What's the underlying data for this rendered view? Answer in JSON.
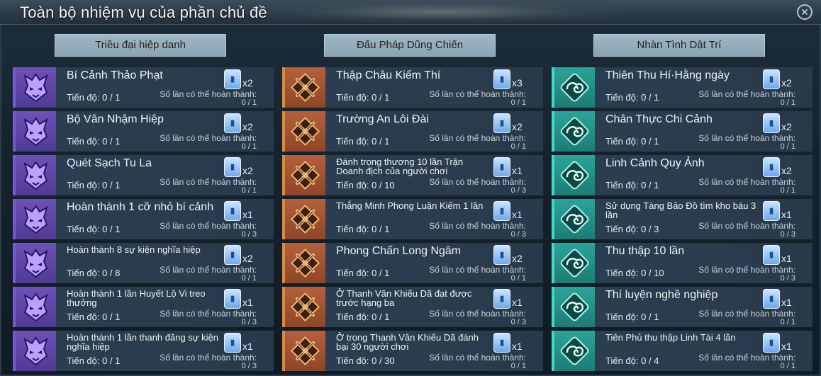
{
  "window": {
    "title": "Toàn bộ nhiệm vụ của phần chủ đề",
    "close_symbol": "✕"
  },
  "columns": [
    {
      "header": "Triều đại hiệp danh",
      "icon": "demon-mask-icon",
      "accent": "#7b56d8",
      "tasks": [
        {
          "name": "Bí Cảnh Thảo Phạt",
          "progress": "Tiến độ: 0 / 1",
          "reward_count": "x2",
          "remain_label": "Số lần có thể hoàn thành:",
          "remain_value": "0 / 1"
        },
        {
          "name": "Bộ Vân Nhậm Hiệp",
          "progress": "Tiến độ: 0 / 1",
          "reward_count": "x2",
          "remain_label": "Số lần có thể hoàn thành:",
          "remain_value": "0 / 1"
        },
        {
          "name": "Quét Sạch Tu La",
          "progress": "Tiến độ: 0 / 1",
          "reward_count": "x2",
          "remain_label": "Số lần có thể hoàn thành:",
          "remain_value": "0 / 1"
        },
        {
          "name": "Hoàn thành 1 cỡ nhỏ bí cảnh",
          "progress": "Tiến độ: 0 / 1",
          "reward_count": "x1",
          "remain_label": "Số lần có thể hoàn thành:",
          "remain_value": "0 / 3"
        },
        {
          "name": "Hoàn thành 8 sự kiện nghĩa hiệp",
          "progress": "Tiến độ: 0 / 8",
          "reward_count": "x2",
          "remain_label": "Số lần có thể hoàn thành:",
          "remain_value": "0 / 1"
        },
        {
          "name": "Hoàn thành 1 lần Huyết Lộ Vi treo thưởng",
          "progress": "Tiến độ: 0 / 1",
          "reward_count": "x1",
          "remain_label": "Số lần có thể hoàn thành:",
          "remain_value": "0 / 3"
        },
        {
          "name": "Hoàn thành 1 lần thanh đăng sự kiện nghĩa hiệp",
          "progress": "Tiến độ: 0 / 1",
          "reward_count": "x1",
          "remain_label": "Số lần có thể hoàn thành:",
          "remain_value": "0 / 3"
        }
      ]
    },
    {
      "header": "Đấu Pháp Dũng Chiến",
      "icon": "crossed-swords-icon",
      "accent": "#d8894e",
      "tasks": [
        {
          "name": "Thập Châu Kiếm Thí",
          "progress": "Tiến độ: 0 / 1",
          "reward_count": "x3",
          "remain_label": "Số lần có thể hoàn thành:",
          "remain_value": "0 / 1"
        },
        {
          "name": "Trường An Lôi Đài",
          "progress": "Tiến độ: 0 / 1",
          "reward_count": "x2",
          "remain_label": "Số lần có thể hoàn thành:",
          "remain_value": "0 / 1"
        },
        {
          "name": "Đánh trọng thương 10 lần Trận Doanh địch của người chơi",
          "progress": "Tiến độ: 0 / 10",
          "reward_count": "x1",
          "remain_label": "Số lần có thể hoàn thành:",
          "remain_value": "0 / 3"
        },
        {
          "name": "Thắng Minh Phong Luận Kiếm 1 lần",
          "progress": "Tiến độ: 0 / 1",
          "reward_count": "x1",
          "remain_label": "Số lần có thể hoàn thành:",
          "remain_value": "0 / 3"
        },
        {
          "name": "Phong Chấn Long Ngâm",
          "progress": "Tiến độ: 0 / 1",
          "reward_count": "x2",
          "remain_label": "Số lần có thể hoàn thành:",
          "remain_value": "0 / 1"
        },
        {
          "name": "Ở Thanh Vân Khiếu Dã đạt được trước hạng ba",
          "progress": "Tiến độ: 0 / 1",
          "reward_count": "x1",
          "remain_label": "Số lần có thể hoàn thành:",
          "remain_value": "0 / 3"
        },
        {
          "name": "Ở trong Thanh Vân Khiếu Dã đánh bại 30 người chơi",
          "progress": "Tiến độ: 0 / 30",
          "reward_count": "x1",
          "remain_label": "Số lần có thể hoàn thành:",
          "remain_value": "0 / 1"
        }
      ]
    },
    {
      "header": "Nhàn Tình Dật Trí",
      "icon": "scroll-cloud-icon",
      "accent": "#45d6c4",
      "tasks": [
        {
          "name": "Thiên Thu Hí·Hằng ngày",
          "progress": "Tiến độ: 0 / 1",
          "reward_count": "x2",
          "remain_label": "Số lần có thể hoàn thành:",
          "remain_value": "0 / 1"
        },
        {
          "name": "Chân Thực Chi Cảnh",
          "progress": "Tiến độ: 0 / 1",
          "reward_count": "x2",
          "remain_label": "Số lần có thể hoàn thành:",
          "remain_value": "0 / 1"
        },
        {
          "name": "Linh Cảnh Quy Ảnh",
          "progress": "Tiến độ: 0 / 1",
          "reward_count": "x2",
          "remain_label": "Số lần có thể hoàn thành:",
          "remain_value": "0 / 1"
        },
        {
          "name": "Sử dụng Tàng Bảo Đồ tìm kho báu 3 lần",
          "progress": "Tiến độ: 0 / 3",
          "reward_count": "x1",
          "remain_label": "Số lần có thể hoàn thành:",
          "remain_value": "0 / 3"
        },
        {
          "name": "Thu thập 10 lần",
          "progress": "Tiến độ: 0 / 10",
          "reward_count": "x1",
          "remain_label": "Số lần có thể hoàn thành:",
          "remain_value": "0 / 3"
        },
        {
          "name": "Thí luyện nghề nghiệp",
          "progress": "Tiến độ: 0 / 1",
          "reward_count": "x1",
          "remain_label": "Số lần có thể hoàn thành:",
          "remain_value": "0 / 1"
        },
        {
          "name": "Tiên Phủ thu thập Linh Tài 4 lần",
          "progress": "Tiến độ: 0 / 4",
          "reward_count": "x1",
          "remain_label": "Số lần có thể hoàn thành:",
          "remain_value": "0 / 1"
        }
      ]
    }
  ]
}
